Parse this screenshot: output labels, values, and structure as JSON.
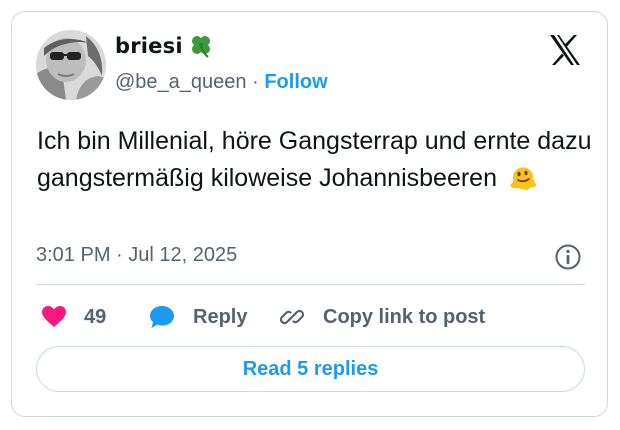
{
  "author": {
    "display_name": "briesi",
    "handle": "@be_a_queen",
    "separator": "·",
    "follow_label": "Follow"
  },
  "tweet": {
    "text": "Ich bin Millenial, höre Gangsterrap und ernte dazu gangstermäßig kiloweise Johannisbeeren",
    "time": "3:01 PM",
    "date_separator": "·",
    "date": "Jul 12, 2025"
  },
  "actions": {
    "like_count": "49",
    "reply_label": "Reply",
    "copy_label": "Copy link to post"
  },
  "read_replies_label": "Read 5 replies",
  "icons": {
    "name_emoji": "four-leaf-clover-icon",
    "text_emoji": "melting-face-icon",
    "logo": "x-logo-icon",
    "info": "info-icon",
    "like": "heart-icon",
    "reply": "speech-bubble-icon",
    "copy": "link-icon"
  },
  "colors": {
    "accent": "#1d9bf0",
    "like": "#f91880",
    "secondary_text": "#536471",
    "border": "#cfd9de"
  }
}
